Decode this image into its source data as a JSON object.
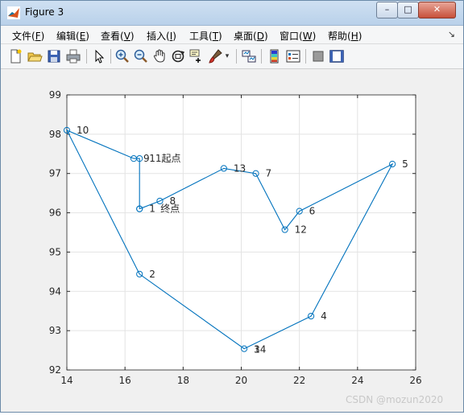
{
  "window": {
    "title": "Figure 3",
    "buttons": {
      "minimize": "–",
      "maximize": "□",
      "close": "✕"
    }
  },
  "menu": {
    "items": [
      {
        "label": "文件(",
        "key": "F",
        "end": ")"
      },
      {
        "label": "编辑(",
        "key": "E",
        "end": ")"
      },
      {
        "label": "查看(",
        "key": "V",
        "end": ")"
      },
      {
        "label": "插入(",
        "key": "I",
        "end": ")"
      },
      {
        "label": "工具(",
        "key": "T",
        "end": ")"
      },
      {
        "label": "桌面(",
        "key": "D",
        "end": ")"
      },
      {
        "label": "窗口(",
        "key": "W",
        "end": ")"
      },
      {
        "label": "帮助(",
        "key": "H",
        "end": ")"
      }
    ],
    "overflow_icon": "dock-arrow-icon"
  },
  "toolbar": {
    "icons": [
      "new-figure-icon",
      "open-file-icon",
      "save-icon",
      "print-icon",
      "select-pointer-icon",
      "zoom-in-icon",
      "zoom-out-icon",
      "pan-hand-icon",
      "rotate-3d-icon",
      "data-cursor-icon",
      "brush-icon",
      "brush-dropdown-icon",
      "link-plot-icon",
      "colorbar-icon",
      "legend-icon",
      "hide-plot-tools-icon",
      "show-plot-tools-icon"
    ]
  },
  "chart_data": {
    "type": "line",
    "title": "",
    "xlabel": "",
    "ylabel": "",
    "xlim": [
      14,
      26
    ],
    "ylim": [
      92,
      99
    ],
    "xticks": [
      "14",
      "16",
      "18",
      "20",
      "22",
      "24",
      "26"
    ],
    "yticks": [
      "92",
      "93",
      "94",
      "95",
      "96",
      "97",
      "98",
      "99"
    ],
    "grid": true,
    "marker": "circle",
    "line_color": "#0072BD",
    "path": [
      {
        "x": 16.5,
        "y": 96.1
      },
      {
        "x": 16.5,
        "y": 97.38
      },
      {
        "x": 16.3,
        "y": 97.38
      },
      {
        "x": 14.0,
        "y": 98.1
      },
      {
        "x": 16.5,
        "y": 94.44
      },
      {
        "x": 20.1,
        "y": 92.54
      },
      {
        "x": 22.4,
        "y": 93.37
      },
      {
        "x": 25.2,
        "y": 97.24
      },
      {
        "x": 22.0,
        "y": 96.04
      },
      {
        "x": 21.5,
        "y": 95.57
      },
      {
        "x": 20.5,
        "y": 97.0
      },
      {
        "x": 19.4,
        "y": 97.13
      },
      {
        "x": 17.2,
        "y": 96.3
      },
      {
        "x": 16.5,
        "y": 96.1
      }
    ],
    "point_labels": [
      {
        "text": "1",
        "x": 16.5,
        "y": 96.1,
        "dx": 12,
        "dy": 4
      },
      {
        "text": "终点",
        "x": 16.5,
        "y": 96.1,
        "dx": 26,
        "dy": 4
      },
      {
        "text": "2",
        "x": 16.5,
        "y": 94.44,
        "dx": 12,
        "dy": 4
      },
      {
        "text": "3",
        "x": 20.1,
        "y": 92.54,
        "dx": 12,
        "dy": 5
      },
      {
        "text": "14",
        "x": 20.1,
        "y": 92.54,
        "dx": 12,
        "dy": 5
      },
      {
        "text": "4",
        "x": 22.4,
        "y": 93.37,
        "dx": 12,
        "dy": 4
      },
      {
        "text": "5",
        "x": 25.2,
        "y": 97.24,
        "dx": 12,
        "dy": 4
      },
      {
        "text": "6",
        "x": 22.0,
        "y": 96.04,
        "dx": 12,
        "dy": 4
      },
      {
        "text": "7",
        "x": 20.5,
        "y": 97.0,
        "dx": 12,
        "dy": 4
      },
      {
        "text": "8",
        "x": 17.2,
        "y": 96.3,
        "dx": 12,
        "dy": 4
      },
      {
        "text": "9",
        "x": 16.3,
        "y": 97.38,
        "dx": 12,
        "dy": 4
      },
      {
        "text": "10",
        "x": 14.0,
        "y": 98.1,
        "dx": 12,
        "dy": 4
      },
      {
        "text": "11起点",
        "x": 16.5,
        "y": 97.38,
        "dx": 12,
        "dy": 4
      },
      {
        "text": "12",
        "x": 21.5,
        "y": 95.57,
        "dx": 12,
        "dy": 4
      },
      {
        "text": "13",
        "x": 19.4,
        "y": 97.13,
        "dx": 12,
        "dy": 4
      }
    ]
  },
  "watermark": "CSDN @mozun2020"
}
